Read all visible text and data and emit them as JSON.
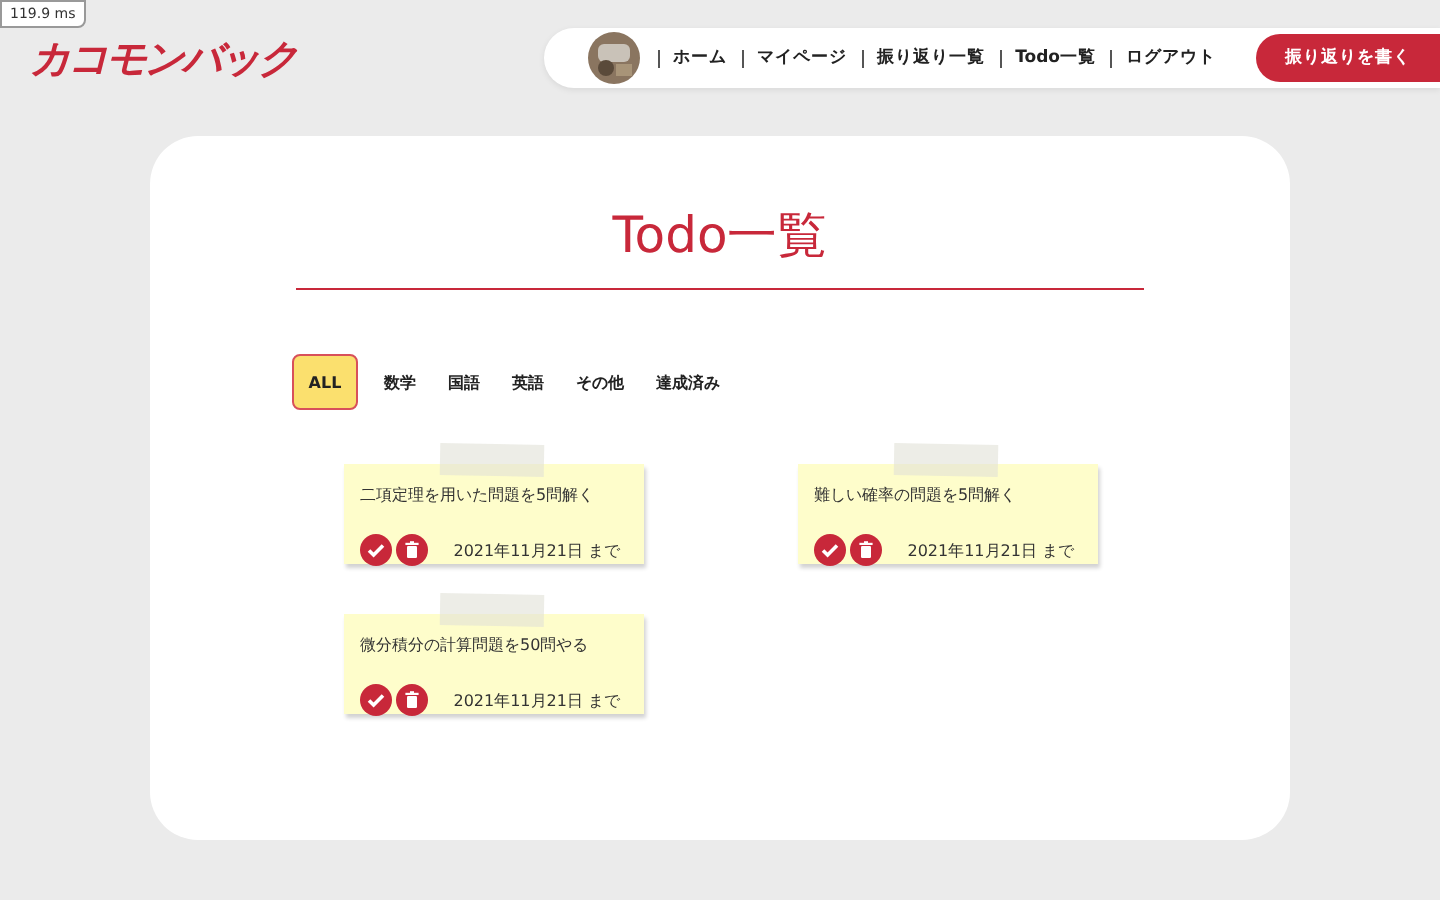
{
  "timing_badge": "119.9 ms",
  "logo": "カコモンバック",
  "nav": {
    "items": [
      {
        "label": "ホーム"
      },
      {
        "label": "マイページ"
      },
      {
        "label": "振り返り一覧"
      },
      {
        "label": "Todo一覧"
      },
      {
        "label": "ログアウト"
      }
    ],
    "cta": "振り返りを書く"
  },
  "title": "Todo一覧",
  "filters": [
    {
      "label": "ALL",
      "selected": true
    },
    {
      "label": "数学",
      "selected": false
    },
    {
      "label": "国語",
      "selected": false
    },
    {
      "label": "英語",
      "selected": false
    },
    {
      "label": "その他",
      "selected": false
    },
    {
      "label": "達成済み",
      "selected": false
    }
  ],
  "todos": [
    {
      "text": "二項定理を用いた問題を5問解く",
      "due": "2021年11月21日 まで"
    },
    {
      "text": "難しい確率の問題を5問解く",
      "due": "2021年11月21日 まで"
    },
    {
      "text": "微分積分の計算問題を50問やる",
      "due": "2021年11月21日 まで"
    }
  ]
}
